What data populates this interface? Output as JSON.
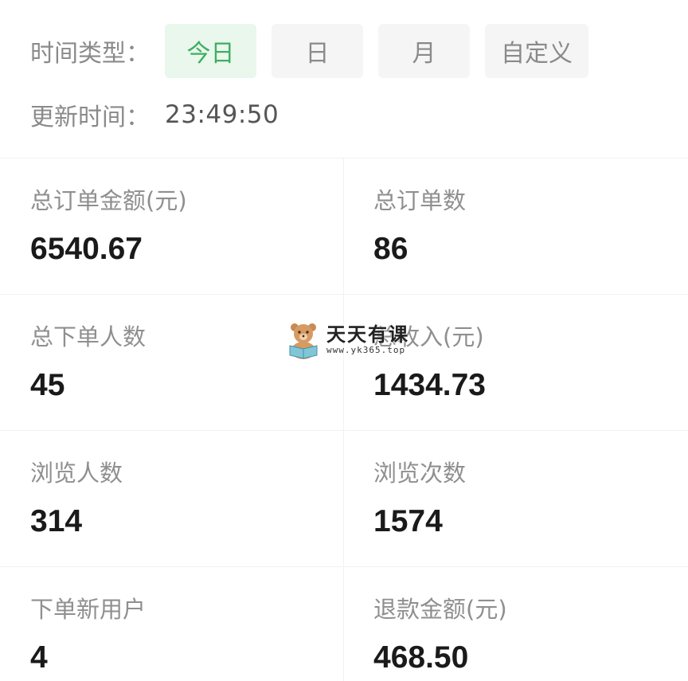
{
  "filter": {
    "label": "时间类型：",
    "options": [
      "今日",
      "日",
      "月",
      "自定义"
    ],
    "selected": "今日",
    "accent_color": "#3fae62"
  },
  "update": {
    "label": "更新时间：",
    "time": "23:49:50"
  },
  "stats": [
    {
      "label": "总订单金额(元)",
      "value": "6540.67"
    },
    {
      "label": "总订单数",
      "value": "86"
    },
    {
      "label": "总下单人数",
      "value": "45"
    },
    {
      "label": "总收入(元)",
      "value": "1434.73"
    },
    {
      "label": "浏览人数",
      "value": "314"
    },
    {
      "label": "浏览次数",
      "value": "1574"
    },
    {
      "label": "下单新用户",
      "value": "4"
    },
    {
      "label": "退款金额(元)",
      "value": "468.50"
    }
  ],
  "watermark": {
    "title": "天天有课",
    "url": "www.yk365.top",
    "icon": "bear-reading-icon"
  }
}
